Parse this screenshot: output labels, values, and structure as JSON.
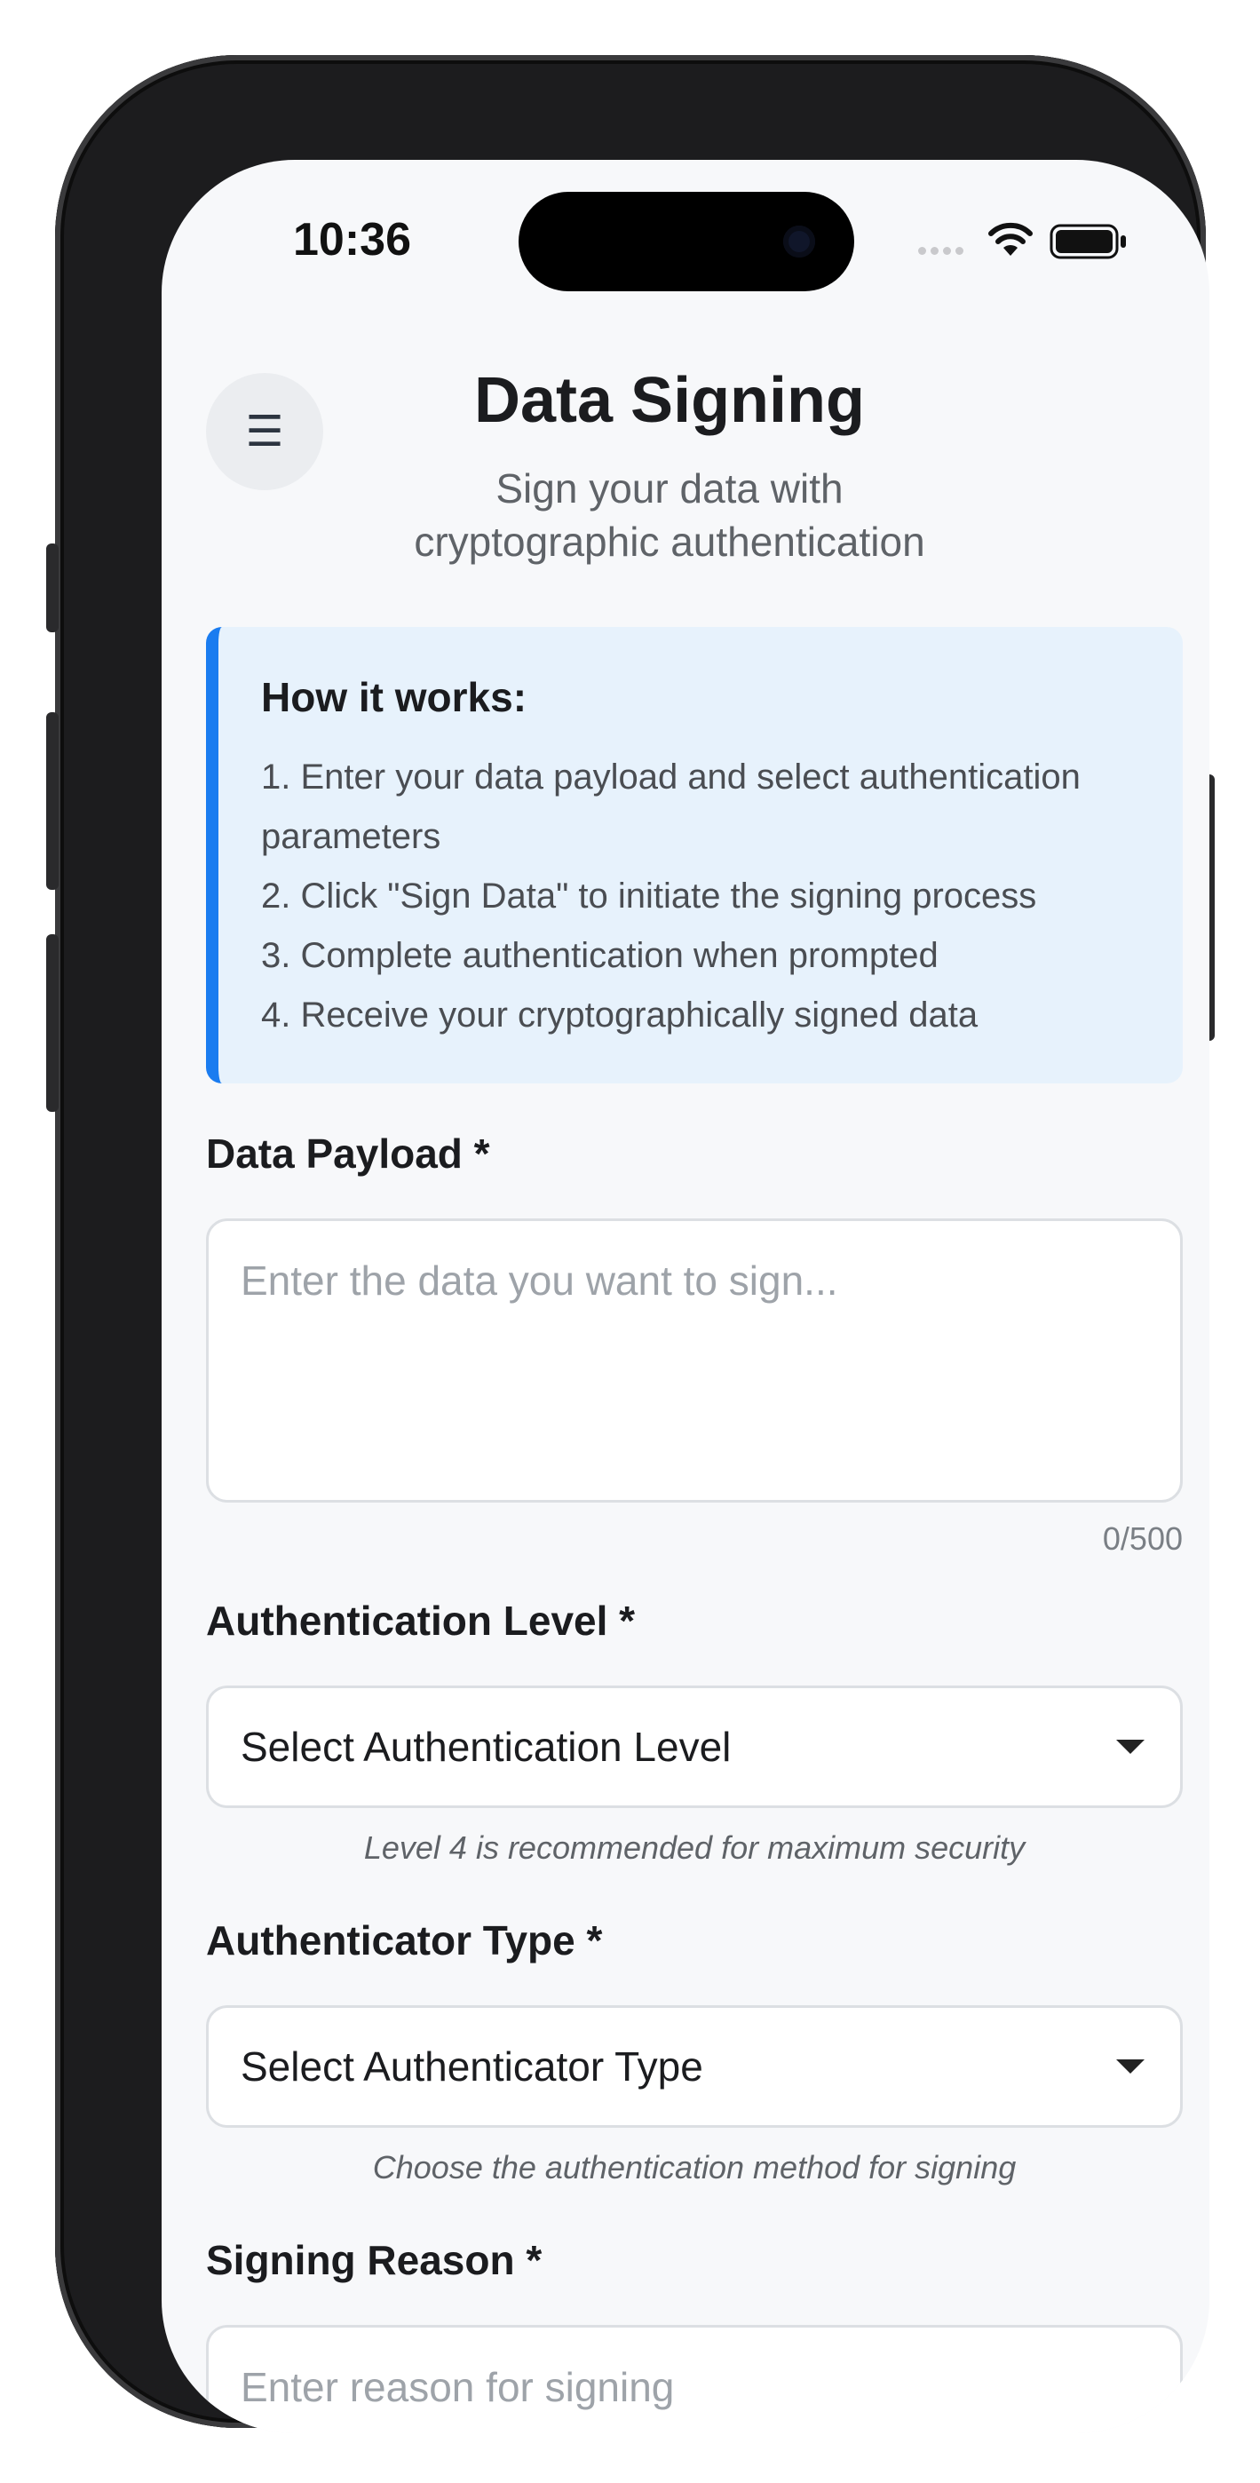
{
  "status": {
    "time": "10:36"
  },
  "header": {
    "menu_icon": "☰",
    "title": "Data Signing",
    "subtitle": "Sign your data with cryptographic authentication"
  },
  "info": {
    "heading": "How it works:",
    "steps": [
      "1. Enter your data payload and select authentication parameters",
      "2. Click \"Sign Data\" to initiate the signing process",
      "3. Complete authentication when prompted",
      "4. Receive your cryptographically signed data"
    ]
  },
  "form": {
    "payload": {
      "label": "Data Payload *",
      "placeholder": "Enter the data you want to sign...",
      "counter": "0/500"
    },
    "auth_level": {
      "label": "Authentication Level *",
      "selected": "Select Authentication Level",
      "hint": "Level 4 is recommended for maximum security"
    },
    "auth_type": {
      "label": "Authenticator Type *",
      "selected": "Select Authenticator Type",
      "hint": "Choose the authentication method for signing"
    },
    "reason": {
      "label": "Signing Reason *",
      "placeholder": "Enter reason for signing"
    }
  },
  "colors": {
    "accent": "#1a7cf0",
    "info_bg": "#e7f2fc",
    "page_bg": "#f7f8fa"
  }
}
